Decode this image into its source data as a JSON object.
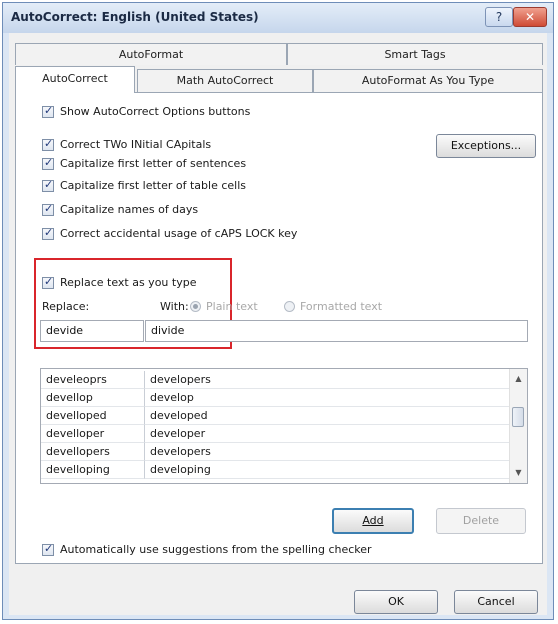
{
  "window": {
    "title": "AutoCorrect: English (United States)",
    "help": "?",
    "close": "✕"
  },
  "tabs_back": [
    "AutoFormat",
    "Smart Tags"
  ],
  "tabs_front": [
    "AutoCorrect",
    "Math AutoCorrect",
    "AutoFormat As You Type"
  ],
  "options": {
    "show_buttons": "Show AutoCorrect Options buttons",
    "two_initial": "Correct TWo INitial CApitals",
    "cap_sentences": "Capitalize first letter of sentences",
    "cap_table": "Capitalize first letter of table cells",
    "cap_days": "Capitalize names of days",
    "caps_lock": "Correct accidental usage of cAPS LOCK key",
    "exceptions_button": "Exceptions..."
  },
  "replace": {
    "checkbox_label": "Replace text as you type",
    "replace_label": "Replace:",
    "with_label": "With:",
    "plain_text": "Plain text",
    "formatted_text": "Formatted text",
    "replace_value": "devide",
    "with_value": "divide"
  },
  "list": [
    {
      "from": "develeoprs",
      "to": "developers"
    },
    {
      "from": "devellop",
      "to": "develop"
    },
    {
      "from": "develloped",
      "to": "developed"
    },
    {
      "from": "develloper",
      "to": "developer"
    },
    {
      "from": "devellopers",
      "to": "developers"
    },
    {
      "from": "develloping",
      "to": "developing"
    }
  ],
  "buttons": {
    "add": "Add",
    "delete": "Delete",
    "ok": "OK",
    "cancel": "Cancel"
  },
  "spelling": "Automatically use suggestions from the spelling checker",
  "colors": {
    "highlight": "#d9252b",
    "title_bar": "#c6d6ec"
  }
}
